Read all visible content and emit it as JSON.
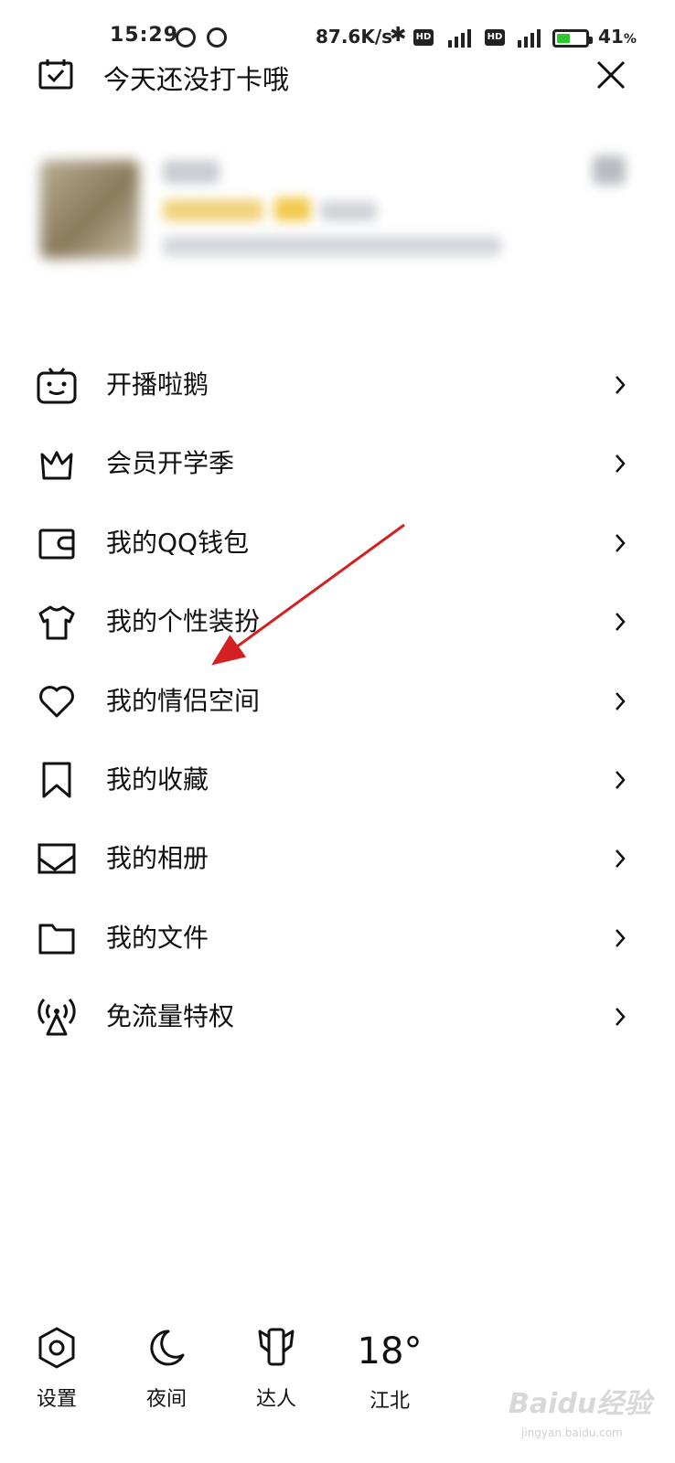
{
  "status_bar": {
    "time": "15:29",
    "network_speed": "87.6K/s",
    "hd_label": "HD",
    "signal_label": "4G",
    "battery_percent": "41",
    "battery_unit": "%",
    "battery_level": 0.41,
    "battery_color": "#2ec72e"
  },
  "header": {
    "checkin_text": "今天还没打卡哦",
    "checkin_icon": "calendar-check-icon",
    "close_icon": "close-icon"
  },
  "menu": {
    "items": [
      {
        "label": "开播啦鹅",
        "icon": "tv-robot-icon"
      },
      {
        "label": "会员开学季",
        "icon": "crown-icon"
      },
      {
        "label": "我的QQ钱包",
        "icon": "wallet-icon"
      },
      {
        "label": "我的个性装扮",
        "icon": "tshirt-icon"
      },
      {
        "label": "我的情侣空间",
        "icon": "heart-icon"
      },
      {
        "label": "我的收藏",
        "icon": "bookmark-icon"
      },
      {
        "label": "我的相册",
        "icon": "photo-icon"
      },
      {
        "label": "我的文件",
        "icon": "folder-icon"
      },
      {
        "label": "免流量特权",
        "icon": "signal-tower-icon"
      }
    ],
    "arrow_icon": "chevron-right-icon"
  },
  "bottom_bar": {
    "settings_label": "设置",
    "night_label": "夜间",
    "expert_label": "达人",
    "weather_temp": "18°",
    "weather_city": "江北"
  },
  "watermark": {
    "text": "Baidu经验",
    "sub": "jingyan.baidu.com"
  },
  "colors": {
    "annotation_arrow": "#d42020",
    "text": "#111111"
  }
}
